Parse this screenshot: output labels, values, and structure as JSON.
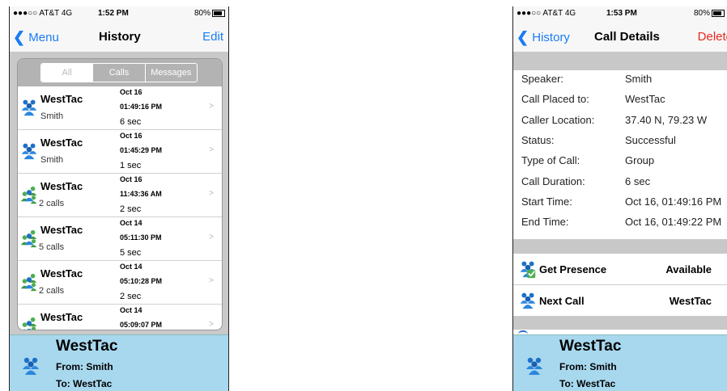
{
  "left": {
    "status": {
      "carrier": "●●●○○ AT&T  4G",
      "time": "1:52 PM",
      "battery": "80%"
    },
    "nav": {
      "back": "Menu",
      "title": "History",
      "right": "Edit"
    },
    "segments": [
      "All",
      "Calls",
      "Messages"
    ],
    "rows": [
      {
        "name": "WestTac",
        "sub": "Smith",
        "date": "Oct 16",
        "time": "01:49:16 PM",
        "dur": "6 sec",
        "icon": "single-user-icon"
      },
      {
        "name": "WestTac",
        "sub": "Smith",
        "date": "Oct 16",
        "time": "01:45:29 PM",
        "dur": "1 sec",
        "icon": "single-user-icon"
      },
      {
        "name": "WestTac",
        "sub": "2 calls",
        "date": "Oct 16",
        "time": "11:43:36 AM",
        "dur": "2 sec",
        "icon": "group-icon"
      },
      {
        "name": "WestTac",
        "sub": "5 calls",
        "date": "Oct 14",
        "time": "05:11:30 PM",
        "dur": "5 sec",
        "icon": "group-icon"
      },
      {
        "name": "WestTac",
        "sub": "2 calls",
        "date": "Oct 14",
        "time": "05:10:28 PM",
        "dur": "2 sec",
        "icon": "group-icon"
      },
      {
        "name": "WestTac",
        "sub": "",
        "date": "Oct 14",
        "time": "05:09:07 PM",
        "dur": "",
        "icon": "group-icon"
      }
    ],
    "bottom": {
      "name": "WestTac",
      "from": "From: Smith",
      "to": "To: WestTac"
    }
  },
  "right": {
    "status": {
      "carrier": "●●●○○ AT&T  4G",
      "time": "1:53 PM",
      "battery": "80%"
    },
    "nav": {
      "back": "History",
      "title": "Call Details",
      "right": "Delete"
    },
    "details": [
      {
        "k": "Speaker:",
        "v": "Smith"
      },
      {
        "k": "Call Placed to:",
        "v": "WestTac"
      },
      {
        "k": "Caller Location:",
        "v": "37.40 N, 79.23 W"
      },
      {
        "k": "Status:",
        "v": "Successful"
      },
      {
        "k": "Type of Call:",
        "v": "Group"
      },
      {
        "k": "Call Duration:",
        "v": "6 sec"
      },
      {
        "k": "Start Time:",
        "v": "Oct 16, 01:49:16 PM"
      },
      {
        "k": "End Time:",
        "v": "Oct 16, 01:49:22 PM"
      }
    ],
    "actions": [
      {
        "label": "Get Presence",
        "value": "Available"
      },
      {
        "label": "Next Call",
        "value": "WestTac"
      }
    ],
    "bottom": {
      "name": "WestTac",
      "from": "From: Smith",
      "to": "To: WestTac"
    }
  },
  "colors": {
    "accent": "#1a7cf5",
    "delete": "#e8281f",
    "bottom_panel": "#a8d8ee",
    "user_icon": "#2a7fd4",
    "group_icon": "#3a9a3a"
  }
}
